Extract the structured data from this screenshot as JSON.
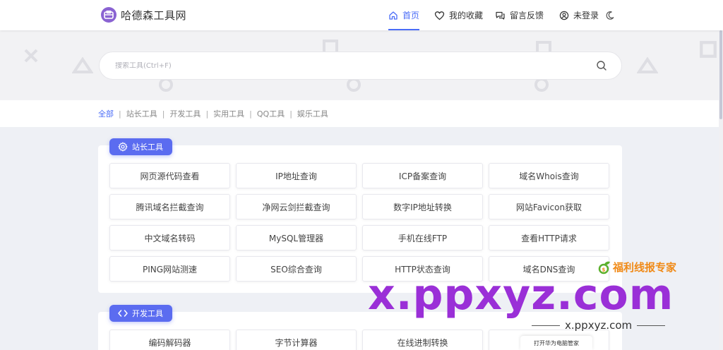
{
  "brand": {
    "name": "哈德森工具网",
    "accent": "#8a63d2"
  },
  "nav": {
    "items": [
      {
        "label": "首页",
        "icon": "home-icon",
        "active": true
      },
      {
        "label": "我的收藏",
        "icon": "heart-icon",
        "active": false
      },
      {
        "label": "留言反馈",
        "icon": "chat-icon",
        "active": false
      },
      {
        "label": "未登录",
        "icon": "user-icon",
        "active": false
      }
    ],
    "theme_toggle_icon": "moon-icon",
    "active_color": "#4a6cf7"
  },
  "search": {
    "placeholder": "搜索工具(Ctrl+F)",
    "value": ""
  },
  "filter": {
    "items": [
      "全部",
      "站长工具",
      "开发工具",
      "实用工具",
      "QQ工具",
      "娱乐工具"
    ],
    "active_index": 0,
    "separator": "|"
  },
  "sections": [
    {
      "title": "站长工具",
      "icon": "gear-icon",
      "tools": [
        "网页源代码查看",
        "IP地址查询",
        "ICP备案查询",
        "域名Whois查询",
        "腾讯域名拦截查询",
        "净网云剑拦截查询",
        "数字IP地址转换",
        "网站Favicon获取",
        "中文域名转码",
        "MySQL管理器",
        "手机在线FTP",
        "查看HTTP请求",
        "PING网站测速",
        "SEO综合查询",
        "HTTP状态查询",
        "域名DNS查询"
      ]
    },
    {
      "title": "开发工具",
      "icon": "code-icon",
      "tools": [
        "编码解码器",
        "字节计算器",
        "在线进制转换",
        ""
      ]
    }
  ],
  "watermark": {
    "brand": "福利线报专家",
    "big_text": "x.ppxyz.com",
    "url": "x.ppxyz.com",
    "tooltip": "打开华为电脑管家"
  },
  "colors": {
    "section_tag": "#5b6cf0",
    "page_bg": "#eef0f5"
  }
}
